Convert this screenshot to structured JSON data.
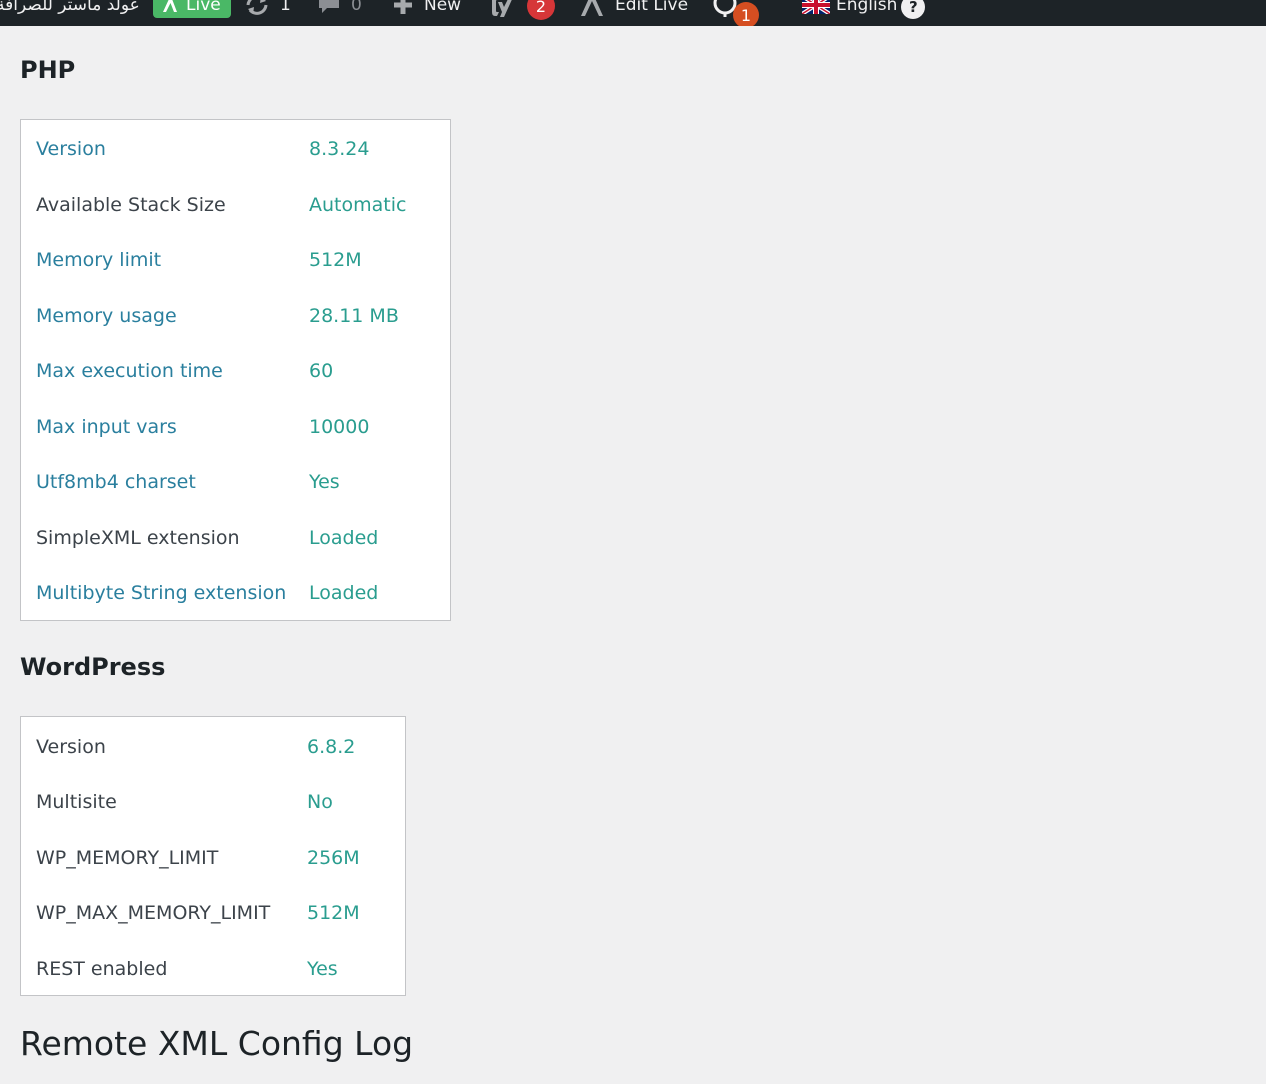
{
  "adminbar": {
    "site_name": "عولد ماستر للصرافة",
    "live_label": "Live",
    "updates_count": "1",
    "comments_count": "0",
    "new_label": "New",
    "yoast_count": "2",
    "edit_live_label": "Edit Live",
    "notifications_count": "1",
    "language_label": "English",
    "help_glyph": "?",
    "icons": [
      "live-logo-icon",
      "updates-icon",
      "comments-icon",
      "plus-icon",
      "yoast-icon",
      "edit-live-logo-icon",
      "notifications-icon",
      "uk-flag-icon",
      "help-icon"
    ],
    "colors": {
      "background": "#1d2327",
      "live": "#4ab866",
      "badge_red": "#d63638",
      "badge_orange": "#d54e21"
    }
  },
  "php": {
    "title": "PHP",
    "rows": [
      {
        "label": "Version",
        "value": "8.3.24"
      },
      {
        "label": "Available Stack Size",
        "value": "Automatic"
      },
      {
        "label": "Memory limit",
        "value": "512M"
      },
      {
        "label": "Memory usage",
        "value": "28.11 MB"
      },
      {
        "label": "Max execution time",
        "value": "60"
      },
      {
        "label": "Max input vars",
        "value": "10000"
      },
      {
        "label": "Utf8mb4 charset",
        "value": "Yes"
      },
      {
        "label": "SimpleXML extension",
        "value": "Loaded"
      },
      {
        "label": "Multibyte String extension",
        "value": "Loaded"
      }
    ]
  },
  "wordpress": {
    "title": "WordPress",
    "rows": [
      {
        "label": "Version",
        "value": "6.8.2"
      },
      {
        "label": "Multisite",
        "value": "No"
      },
      {
        "label": "WP_MEMORY_LIMIT",
        "value": "256M"
      },
      {
        "label": "WP_MAX_MEMORY_LIMIT",
        "value": "512M"
      },
      {
        "label": "REST enabled",
        "value": "Yes"
      }
    ]
  },
  "remote_log": {
    "title": "Remote XML Config Log"
  },
  "colors": {
    "page_background": "#f0f0f1",
    "value_text": "#2a9d8f",
    "link_label": "#2a7f9e",
    "plain_label": "#3c434a"
  }
}
